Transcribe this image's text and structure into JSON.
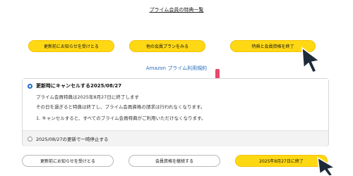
{
  "header": {
    "link_title": "プライム会員の特典一覧"
  },
  "top_buttons": [
    {
      "label": "更新前にお知らせを受けとる"
    },
    {
      "label": "他の会員プランをみる"
    },
    {
      "label": "特典と会員資格を終了"
    }
  ],
  "terms_link": "Amazon プライム利用規約",
  "options": {
    "option1": {
      "title": "更新時にキャンセルする2025/08/27",
      "line1": "プライム会員特典は2025年8月27日に終了します",
      "line2": "その日を過ぎると特典は終了し、プライム会員資格の請求は行われなくなります。",
      "line3": "1. キャンセルすると、すべてのプライム会員特典がご利用いただけなくなります。"
    },
    "option2": {
      "title": "2025/08/27の更新で一時停止する"
    }
  },
  "bottom_buttons": [
    {
      "label": "更新前にお知らせを受けとる"
    },
    {
      "label": "会員資格を継続する"
    },
    {
      "label": "2025年8月27日に終了"
    }
  ],
  "colors": {
    "accent_yellow": "#ffd814",
    "link_blue": "#2a6ebb",
    "arrow_pink": "#e8476a",
    "cursor": "#1e2a38"
  },
  "icons": {
    "arrow": "down-arrow-icon",
    "pointer": "mouse-cursor-icon"
  }
}
